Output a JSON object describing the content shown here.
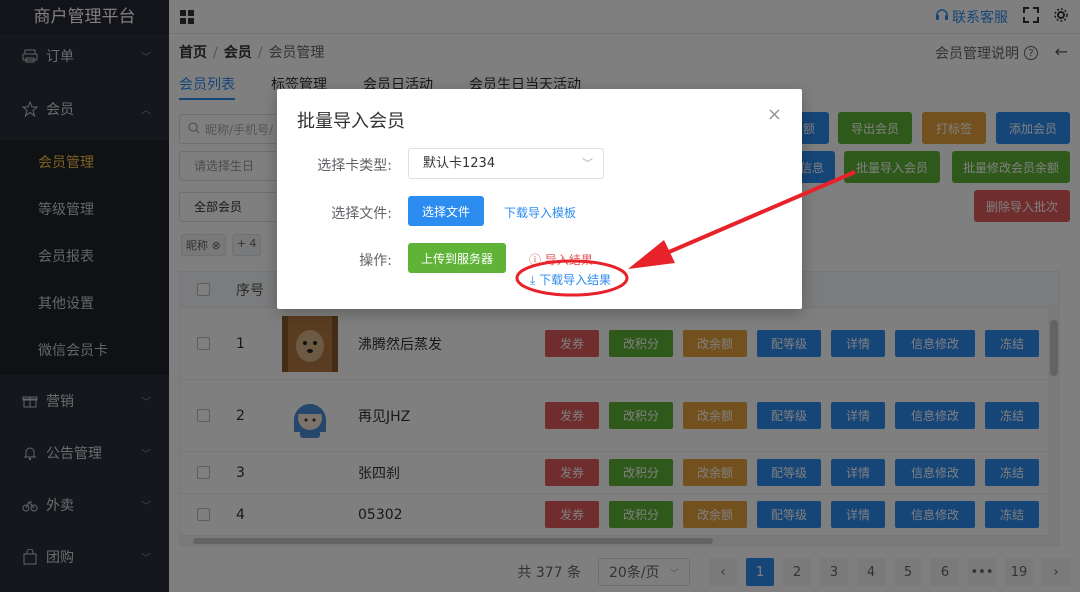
{
  "brand": "商户管理平台",
  "sidebar": {
    "items": [
      {
        "label": "订单",
        "icon": "printer-icon"
      },
      {
        "label": "会员",
        "icon": "star-icon"
      },
      {
        "label": "营销",
        "icon": "gift-icon"
      },
      {
        "label": "公告管理",
        "icon": "bell-icon"
      },
      {
        "label": "外卖",
        "icon": "bike-icon"
      },
      {
        "label": "团购",
        "icon": "bag-icon"
      }
    ],
    "sub_items": [
      "会员管理",
      "等级管理",
      "会员报表",
      "其他设置",
      "微信会员卡"
    ]
  },
  "header": {
    "service": "联系客服",
    "icons": [
      "headset-icon",
      "fullscreen-icon",
      "settings-icon"
    ]
  },
  "breadcrumb": {
    "home": "首页",
    "sep": "/",
    "section": "会员",
    "current": "会员管理"
  },
  "help": {
    "label": "会员管理说明",
    "q": "?",
    "back": "←"
  },
  "tabs": [
    "会员列表",
    "标签管理",
    "会员日活动",
    "会员生日当天活动"
  ],
  "filters": {
    "search_placeholder": "昵称/手机号/",
    "birthday_placeholder": "请选择生日",
    "group": "全部会员",
    "tag": "昵称",
    "more": "+ 4"
  },
  "actions": {
    "recharge_partial": "额",
    "export": "导出会员",
    "tag": "打标签",
    "add": "添加会员",
    "info_partial": "信息",
    "batch_import": "批量导入会员",
    "batch_balance": "批量修改会员余额",
    "delete_batch": "删除导入批次"
  },
  "table": {
    "headers": {
      "no": "序号"
    },
    "rows": [
      {
        "no": "1",
        "name": "沸腾然后蒸发"
      },
      {
        "no": "2",
        "name": "再见JHZ"
      },
      {
        "no": "3",
        "name": "张四刹"
      },
      {
        "no": "4",
        "name": "05302"
      }
    ],
    "ops": {
      "coupon": "发券",
      "points": "改积分",
      "balance": "改余额",
      "level": "配等级",
      "detail": "详情",
      "edit": "信息修改",
      "freeze": "冻结"
    }
  },
  "pagination": {
    "total": "共 377 条",
    "size": "20条/页",
    "prev": "‹",
    "next": "›",
    "pages": [
      "1",
      "2",
      "3",
      "4",
      "5",
      "6",
      "•••",
      "19"
    ],
    "current": "1"
  },
  "modal": {
    "title": "批量导入会员",
    "close": "×",
    "card_type_label": "选择卡类型:",
    "card_type_value": "默认卡1234",
    "file_label": "选择文件:",
    "choose_file": "选择文件",
    "template_link": "下载导入模板",
    "op_label": "操作:",
    "upload": "上传到服务器",
    "result_partial": "导入结果",
    "download_result": "下载导入结果"
  },
  "colors": {
    "accent": "#2d8cf0",
    "green": "#5fb336",
    "orange": "#e6a23c",
    "red": "#e05a5a",
    "sidebar": "#2b2f3a",
    "active_sub": "#f5c343",
    "annotation": "#e8222a"
  }
}
